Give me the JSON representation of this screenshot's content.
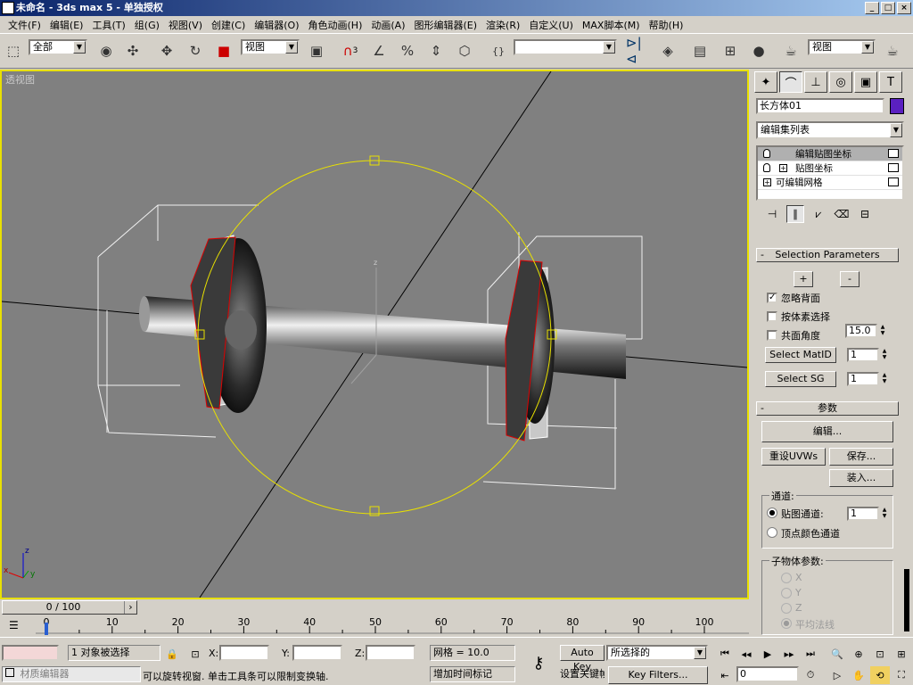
{
  "window": {
    "title": "未命名 - 3ds max 5 - 单独授权",
    "minimize": "_",
    "maximize": "□",
    "close": "×"
  },
  "menu": [
    "文件(F)",
    "编辑(E)",
    "工具(T)",
    "组(G)",
    "视图(V)",
    "创建(C)",
    "编辑器(O)",
    "角色动画(H)",
    "动画(A)",
    "图形编辑器(E)",
    "渲染(R)",
    "自定义(U)",
    "MAX脚本(M)",
    "帮助(H)"
  ],
  "toolbar": {
    "selection_filter": "全部",
    "ref_coord": "视图",
    "named_selection": "",
    "render_type": "视图",
    "snap_angle_sup": "3"
  },
  "viewport": {
    "label": "透视图",
    "axis_x": "x",
    "axis_y": "y",
    "axis_z": "z",
    "axis_small_z": "z"
  },
  "cmdpanel": {
    "tabs": [
      "create-icon",
      "modify-icon",
      "hierarchy-icon",
      "motion-icon",
      "display-icon",
      "utilities-icon"
    ],
    "object_name": "长方体01",
    "object_color": "#5a20c0",
    "modifier_list": "编辑集列表",
    "stack": [
      {
        "label": "编辑贴图坐标",
        "selected": true
      },
      {
        "label": "贴图坐标",
        "selected": false
      },
      {
        "label": "可编辑网格",
        "selected": false
      }
    ],
    "selection_parameters": {
      "title": "Selection Parameters",
      "plus": "+",
      "minus": "-",
      "ignore_backfaces": "忽略背面",
      "ignore_backfaces_checked": true,
      "select_by_element": "按体素选择",
      "planar_angle": "共面角度",
      "planar_angle_value": "15.0",
      "select_matid": "Select MatID",
      "matid_value": "1",
      "select_sg": "Select SG",
      "sg_value": "1"
    },
    "params": {
      "title": "参数",
      "edit": "编辑...",
      "reset_uvws": "重设UVWs",
      "save": "保存...",
      "load": "装入...",
      "channel_group": "通道:",
      "map_channel": "贴图通道:",
      "map_channel_value": "1",
      "vertex_color_channel": "顶点颜色通道",
      "subobject_group": "子物体参数:",
      "x": "X",
      "y": "Y",
      "z": "Z",
      "avg_normals": "平均法线"
    }
  },
  "timeline": {
    "frame": "0 / 100",
    "ticks": [
      "0",
      "10",
      "20",
      "30",
      "40",
      "50",
      "60",
      "70",
      "80",
      "90",
      "100"
    ]
  },
  "status": {
    "maxscript": "材质编辑器",
    "selected": "1 对象被选择",
    "x_label": "X:",
    "y_label": "Y:",
    "z_label": "Z:",
    "grid": "网格 = 10.0",
    "prompt": "可以旋转视窗. 单击工具条可以限制变换轴.",
    "add_time_tag": "增加时间标记",
    "auto_key": "Auto Key",
    "set_key": "设置关键帧",
    "key_mode": "所选择的",
    "key_filters": "Key Filters...",
    "current_frame": "0"
  }
}
